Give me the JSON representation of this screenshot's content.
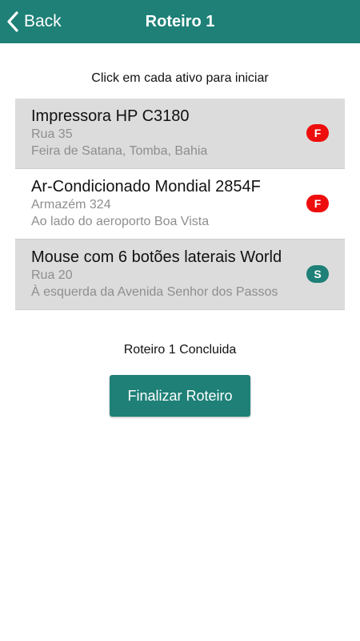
{
  "header": {
    "back_label": "Back",
    "title": "Roteiro 1",
    "bg_color": "#1e8077"
  },
  "instruction": "Click em cada ativo para iniciar",
  "assets": [
    {
      "name": "Impressora HP C3180",
      "location": "Rua 35",
      "detail": "Feira de Satana, Tomba, Bahia",
      "badge": "F",
      "badge_color": "#ee0d0d"
    },
    {
      "name": "Ar-Condicionado Mondial 2854F",
      "location": "Armazém 324",
      "detail": "Ao lado do aeroporto Boa Vista",
      "badge": "F",
      "badge_color": "#ee0d0d"
    },
    {
      "name": "Mouse com 6 botões laterais World",
      "location": "Rua 20",
      "detail": "À esquerda da Avenida Senhor dos Passos",
      "badge": "S",
      "badge_color": "#1e8077"
    }
  ],
  "status_text": "Roteiro 1 Concluida",
  "finish_button": "Finalizar Roteiro"
}
